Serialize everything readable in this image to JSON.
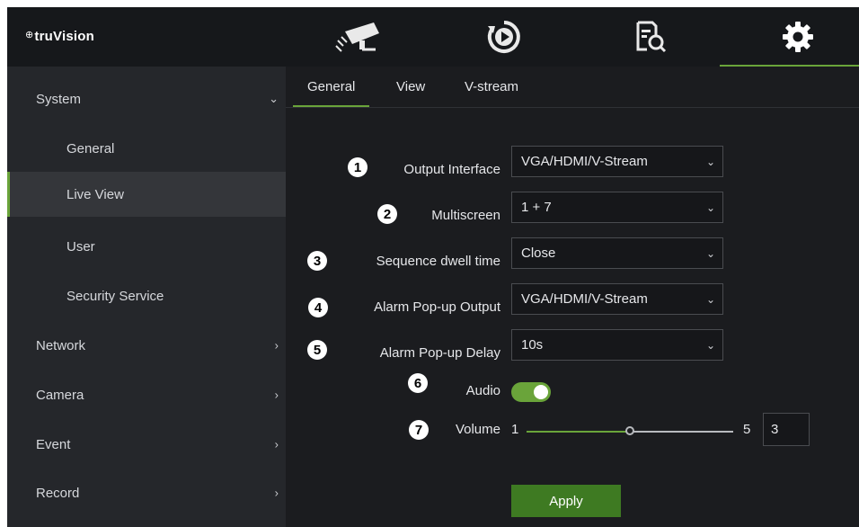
{
  "app": {
    "logo": "truVision"
  },
  "topbar": {
    "icons": [
      "camera-icon",
      "playback-icon",
      "search-icon",
      "gear-icon"
    ],
    "active_icon": "gear-icon",
    "accent": "#6aa43a"
  },
  "sidebar": {
    "items": [
      {
        "label": "System",
        "expanded": true
      },
      {
        "label": "General"
      },
      {
        "label": "Live View",
        "selected": true
      },
      {
        "label": "User"
      },
      {
        "label": "Security Service"
      },
      {
        "label": "Network"
      },
      {
        "label": "Camera"
      },
      {
        "label": "Event"
      },
      {
        "label": "Record"
      }
    ]
  },
  "tabs": [
    {
      "label": "General",
      "active": true
    },
    {
      "label": "View"
    },
    {
      "label": "V-stream"
    }
  ],
  "form": {
    "output_interface": {
      "badge": "1",
      "label": "Output Interface",
      "value": "VGA/HDMI/V-Stream"
    },
    "multiscreen": {
      "badge": "2",
      "label": "Multiscreen",
      "value": "1 + 7"
    },
    "sequence_dwell": {
      "badge": "3",
      "label": "Sequence dwell time",
      "value": "Close"
    },
    "alarm_output": {
      "badge": "4",
      "label": "Alarm Pop-up Output",
      "value": "VGA/HDMI/V-Stream"
    },
    "alarm_delay": {
      "badge": "5",
      "label": "Alarm Pop-up Delay",
      "value": "10s"
    },
    "audio": {
      "badge": "6",
      "label": "Audio",
      "enabled": true
    },
    "volume": {
      "badge": "7",
      "label": "Volume",
      "min": "1",
      "max": "5",
      "value": "3"
    },
    "apply_label": "Apply"
  }
}
